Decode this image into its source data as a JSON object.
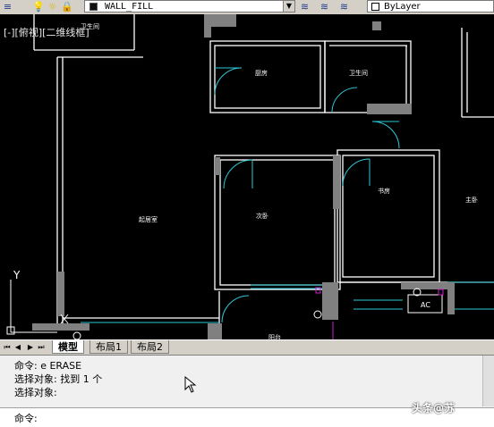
{
  "toolbar": {
    "layer_name": "WALL_FILL",
    "linetype": "ByLayer"
  },
  "viewport": {
    "label": "[-][俯视][二维线框]"
  },
  "rooms": {
    "kitchen": "厨房",
    "bath": "卫生间",
    "living": "起居室",
    "bedroom1": "次卧",
    "bedroom2": "书房",
    "master": "主卧",
    "balcony": "阳台",
    "top_left": "卫生间",
    "ac": "AC"
  },
  "tabs": {
    "model": "模型",
    "layout1": "布局1",
    "layout2": "布局2"
  },
  "command": {
    "line1": "命令: e ERASE",
    "line2": "选择对象: 找到 1 个",
    "line3": "选择对象:",
    "prompt": "命令:"
  },
  "watermark": "头条@苏"
}
